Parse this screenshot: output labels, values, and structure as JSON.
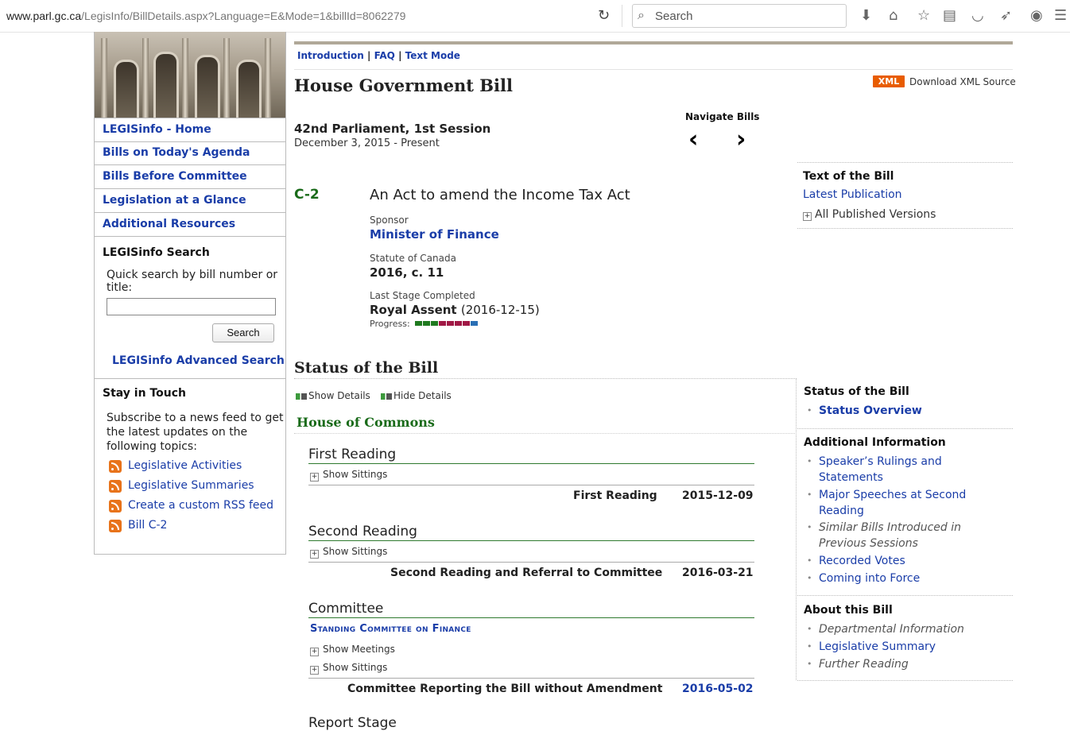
{
  "browser": {
    "url_domain": "www.parl.gc.ca",
    "url_path": "/LegisInfo/BillDetails.aspx?Language=E&Mode=1&billId=8062279",
    "search_placeholder": "Search"
  },
  "sidebar": {
    "nav": [
      {
        "label": "LEGISinfo - Home"
      },
      {
        "label": "Bills on Today's Agenda"
      },
      {
        "label": "Bills Before Committee"
      },
      {
        "label": "Legislation at a Glance"
      },
      {
        "label": "Additional Resources"
      }
    ],
    "search_heading": "LEGISinfo Search",
    "search_desc": "Quick search by bill number or title:",
    "search_value": "",
    "search_button": "Search",
    "advanced_search": "LEGISinfo Advanced Search",
    "stay_heading": "Stay in Touch",
    "stay_desc": "Subscribe to a news feed to get the latest updates on the following topics:",
    "feeds": [
      {
        "label": "Legislative Activities"
      },
      {
        "label": "Legislative Summaries"
      },
      {
        "label": "Create a custom RSS feed"
      },
      {
        "label": "Bill C-2"
      }
    ]
  },
  "top_links": {
    "introduction": "Introduction",
    "faq": "FAQ",
    "text_mode": "Text Mode",
    "sep": "|"
  },
  "bill": {
    "type_heading": "House Government Bill",
    "xml_badge": "XML",
    "xml_text": "Download XML Source",
    "navigate_label": "Navigate Bills",
    "nav_prev": "‹",
    "nav_next": "›",
    "parliament": "42nd Parliament, 1st Session",
    "dates": "December 3, 2015 - Present",
    "number": "C-2",
    "title": "An Act to amend the Income Tax Act",
    "sponsor_label": "Sponsor",
    "sponsor": "Minister of Finance",
    "statute_label": "Statute of Canada",
    "statute": "2016, c. 11",
    "last_stage_label": "Last Stage Completed",
    "last_stage": "Royal Assent",
    "last_stage_date": "(2016-12-15)",
    "progress_label": "Progress:",
    "progress_colors": [
      "#1f7a1f",
      "#1f7a1f",
      "#1f7a1f",
      "#a01845",
      "#a01845",
      "#a01845",
      "#a01845",
      "#2a6fb5"
    ]
  },
  "text_of_bill": {
    "heading": "Text of the Bill",
    "latest": "Latest Publication",
    "all_versions": "All Published Versions"
  },
  "status": {
    "heading": "Status of the Bill",
    "show_details": "Show Details",
    "hide_details": "Hide Details",
    "chamber": "House of Commons",
    "stages": [
      {
        "name": "First Reading",
        "toggles": [
          "Show Sittings"
        ],
        "event": "First Reading",
        "date": "2015-12-09"
      },
      {
        "name": "Second Reading",
        "toggles": [
          "Show Sittings"
        ],
        "event": "Second Reading and Referral to Committee",
        "date": "2016-03-21"
      },
      {
        "name": "Committee",
        "committee": "Standing Committee on Finance",
        "toggles": [
          "Show Meetings",
          "Show Sittings"
        ],
        "event": "Committee Reporting the Bill without Amendment",
        "date": "2016-05-02"
      },
      {
        "name": "Report Stage"
      }
    ]
  },
  "right_sidebar": {
    "status_heading": "Status of the Bill",
    "status_items": [
      "Status Overview"
    ],
    "additional_heading": "Additional Information",
    "additional_items": [
      "Speaker’s Rulings and Statements",
      "Major Speeches at Second Reading",
      "Similar Bills Introduced in Previous Sessions",
      "Recorded Votes",
      "Coming into Force"
    ],
    "about_heading": "About this Bill",
    "about_items": [
      "Departmental Information",
      "Legislative Summary",
      "Further Reading"
    ]
  }
}
